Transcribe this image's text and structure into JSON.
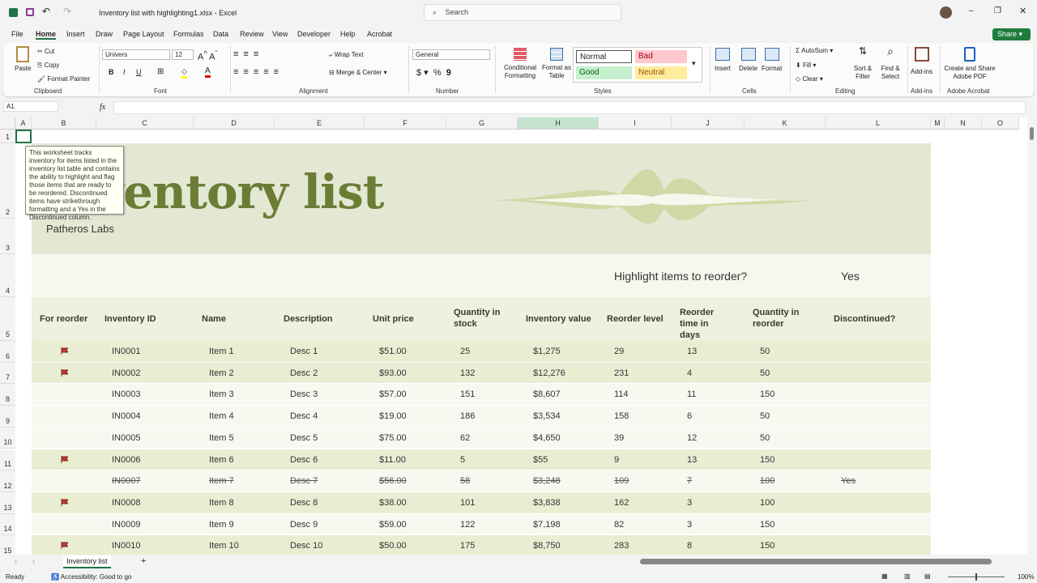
{
  "app": {
    "title": "Inventory list with highlighting1.xlsx  -  Excel",
    "search_placeholder": "Search",
    "share": "Share"
  },
  "menu": [
    "File",
    "Home",
    "Insert",
    "Draw",
    "Page Layout",
    "Formulas",
    "Data",
    "Review",
    "View",
    "Developer",
    "Help",
    "Acrobat"
  ],
  "ribbon": {
    "clipboard": {
      "paste": "Paste",
      "cut": "Cut",
      "copy": "Copy",
      "format_painter": "Format Painter",
      "label": "Clipboard"
    },
    "font": {
      "name": "Univers",
      "size": "12",
      "bold": "B",
      "italic": "I",
      "underline": "U",
      "label": "Font"
    },
    "alignment": {
      "wrap": "Wrap Text",
      "merge": "Merge & Center",
      "label": "Alignment"
    },
    "number": {
      "format": "General",
      "currency": "$",
      "percent": "%",
      "comma": "9",
      "label": "Number"
    },
    "styles": {
      "conditional": "Conditional Formatting",
      "format_table": "Format as Table",
      "normal": "Normal",
      "bad": "Bad",
      "good": "Good",
      "neutral": "Neutral",
      "label": "Styles"
    },
    "cells": {
      "insert": "Insert",
      "delete": "Delete",
      "format": "Format",
      "label": "Cells"
    },
    "editing": {
      "autosum": "AutoSum",
      "fill": "Fill",
      "clear": "Clear",
      "sort": "Sort & Filter",
      "find": "Find & Select",
      "label": "Editing"
    },
    "addins": {
      "addins": "Add-ins",
      "label": "Add-ins"
    },
    "acrobat": {
      "create": "Create and Share Adobe PDF",
      "label": "Adobe Acrobat"
    }
  },
  "formula_bar": {
    "name_box": "A1",
    "fx": "fx",
    "value": ""
  },
  "columns": [
    "A",
    "B",
    "C",
    "D",
    "E",
    "F",
    "G",
    "H",
    "I",
    "J",
    "K",
    "L",
    "M",
    "N",
    "O"
  ],
  "rows": [
    "1",
    "2",
    "3",
    "4",
    "5",
    "6",
    "7",
    "8",
    "9",
    "10",
    "11",
    "12",
    "13",
    "14",
    "15"
  ],
  "sheet": {
    "title": "Inventory list",
    "company": "Patheros Labs",
    "highlight_q": "Highlight items to reorder?",
    "highlight_a": "Yes",
    "comment": "This worksheet tracks inventory for items listed in the inventory list table and contains the ability to highlight and flag those items that are ready to be reordered. Discontinued items have strikethrough formatting and a Yes in the Discontinued column.",
    "headers": [
      "For reorder",
      "Inventory ID",
      "Name",
      "Description",
      "Unit price",
      "Quantity in stock",
      "Inventory value",
      "Reorder level",
      "Reorder time in days",
      "Quantity in reorder",
      "Discontinued?"
    ],
    "items": [
      {
        "flag": true,
        "id": "IN0001",
        "name": "Item 1",
        "desc": "Desc 1",
        "price": "$51.00",
        "qty": "25",
        "value": "$1,275",
        "level": "29",
        "days": "13",
        "reorder": "50",
        "disc": ""
      },
      {
        "flag": true,
        "id": "IN0002",
        "name": "Item 2",
        "desc": "Desc 2",
        "price": "$93.00",
        "qty": "132",
        "value": "$12,276",
        "level": "231",
        "days": "4",
        "reorder": "50",
        "disc": ""
      },
      {
        "flag": false,
        "id": "IN0003",
        "name": "Item 3",
        "desc": "Desc 3",
        "price": "$57.00",
        "qty": "151",
        "value": "$8,607",
        "level": "114",
        "days": "11",
        "reorder": "150",
        "disc": ""
      },
      {
        "flag": false,
        "id": "IN0004",
        "name": "Item 4",
        "desc": "Desc 4",
        "price": "$19.00",
        "qty": "186",
        "value": "$3,534",
        "level": "158",
        "days": "6",
        "reorder": "50",
        "disc": ""
      },
      {
        "flag": false,
        "id": "IN0005",
        "name": "Item 5",
        "desc": "Desc 5",
        "price": "$75.00",
        "qty": "62",
        "value": "$4,650",
        "level": "39",
        "days": "12",
        "reorder": "50",
        "disc": ""
      },
      {
        "flag": true,
        "id": "IN0006",
        "name": "Item 6",
        "desc": "Desc 6",
        "price": "$11.00",
        "qty": "5",
        "value": "$55",
        "level": "9",
        "days": "13",
        "reorder": "150",
        "disc": ""
      },
      {
        "flag": false,
        "id": "IN0007",
        "name": "Item 7",
        "desc": "Desc 7",
        "price": "$56.00",
        "qty": "58",
        "value": "$3,248",
        "level": "109",
        "days": "7",
        "reorder": "100",
        "disc": "Yes"
      },
      {
        "flag": true,
        "id": "IN0008",
        "name": "Item 8",
        "desc": "Desc 8",
        "price": "$38.00",
        "qty": "101",
        "value": "$3,838",
        "level": "162",
        "days": "3",
        "reorder": "100",
        "disc": ""
      },
      {
        "flag": false,
        "id": "IN0009",
        "name": "Item 9",
        "desc": "Desc 9",
        "price": "$59.00",
        "qty": "122",
        "value": "$7,198",
        "level": "82",
        "days": "3",
        "reorder": "150",
        "disc": ""
      },
      {
        "flag": true,
        "id": "IN0010",
        "name": "Item 10",
        "desc": "Desc 10",
        "price": "$50.00",
        "qty": "175",
        "value": "$8,750",
        "level": "283",
        "days": "8",
        "reorder": "150",
        "disc": ""
      }
    ]
  },
  "tabs": {
    "sheet": "Inventory list",
    "add": "+"
  },
  "status": {
    "ready": "Ready",
    "accessibility": "Accessibility: Good to go",
    "zoom": "100%"
  },
  "colors": {
    "accent": "#217346",
    "title": "#6b7d35",
    "flag": "#c0392b",
    "band": "#e9eed3",
    "plain": "#f8f8f0"
  }
}
